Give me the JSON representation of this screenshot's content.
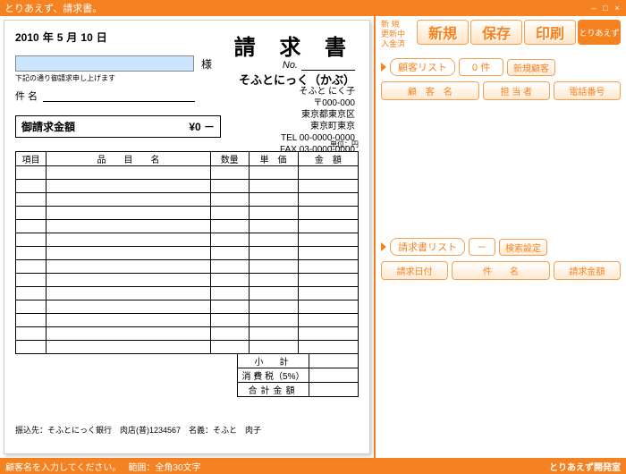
{
  "title_bar": {
    "title": "とりあえず、請求書。"
  },
  "invoice": {
    "date_year": "2010",
    "year_suffix": "年",
    "date_month": "5",
    "month_suffix": "月",
    "date_day": "10",
    "day_suffix": "日",
    "title": "請 求 書",
    "no_label": "No.",
    "sama": "様",
    "note": "下記の通り御請求申し上げます",
    "subject_label": "件 名",
    "company": {
      "name": "そふとにっく（かぶ）",
      "person": "そふと にく子",
      "zip": "〒000-000",
      "addr1": "東京都東京区",
      "addr2": "東京町東京",
      "tel": "TEL 00-0000-0000",
      "fax": "FAX 03-0000-0000"
    },
    "total_label": "御請求金額",
    "total_value": "¥0 －",
    "unit_note": "単位：円",
    "headers": {
      "item": "項目",
      "name": "品　　目　　名",
      "qty": "数量",
      "price": "単　価",
      "amount": "金　額"
    },
    "summary": {
      "subtotal": "小　計",
      "tax": "消 費 税（5%）",
      "grand": "合計金額"
    },
    "bank": "振込先：そふとにっく銀行　肉店(普)1234567　名義：そふと　肉子"
  },
  "right": {
    "status": {
      "l1": "新 規",
      "l2": "更新中",
      "l3": "入金済"
    },
    "btn_new": "新規",
    "btn_save": "保存",
    "btn_print": "印刷",
    "btn_logo": "とりあえず",
    "cust_list": "顧客リスト",
    "count0": "0 件",
    "btn_newcust": "新規顧客",
    "col_custname": "顧　客　名",
    "col_person": "担 当 者",
    "col_phone": "電話番号",
    "inv_list": "請求書リスト",
    "dash": "－",
    "btn_search": "検索設定",
    "col_date": "請求日付",
    "col_subject": "件　　名",
    "col_amount": "請求金額"
  },
  "status_bar": {
    "msg": "顧客名を入力してください。",
    "range": "範囲：全角30文字",
    "brand": "とりあえず開発室"
  }
}
